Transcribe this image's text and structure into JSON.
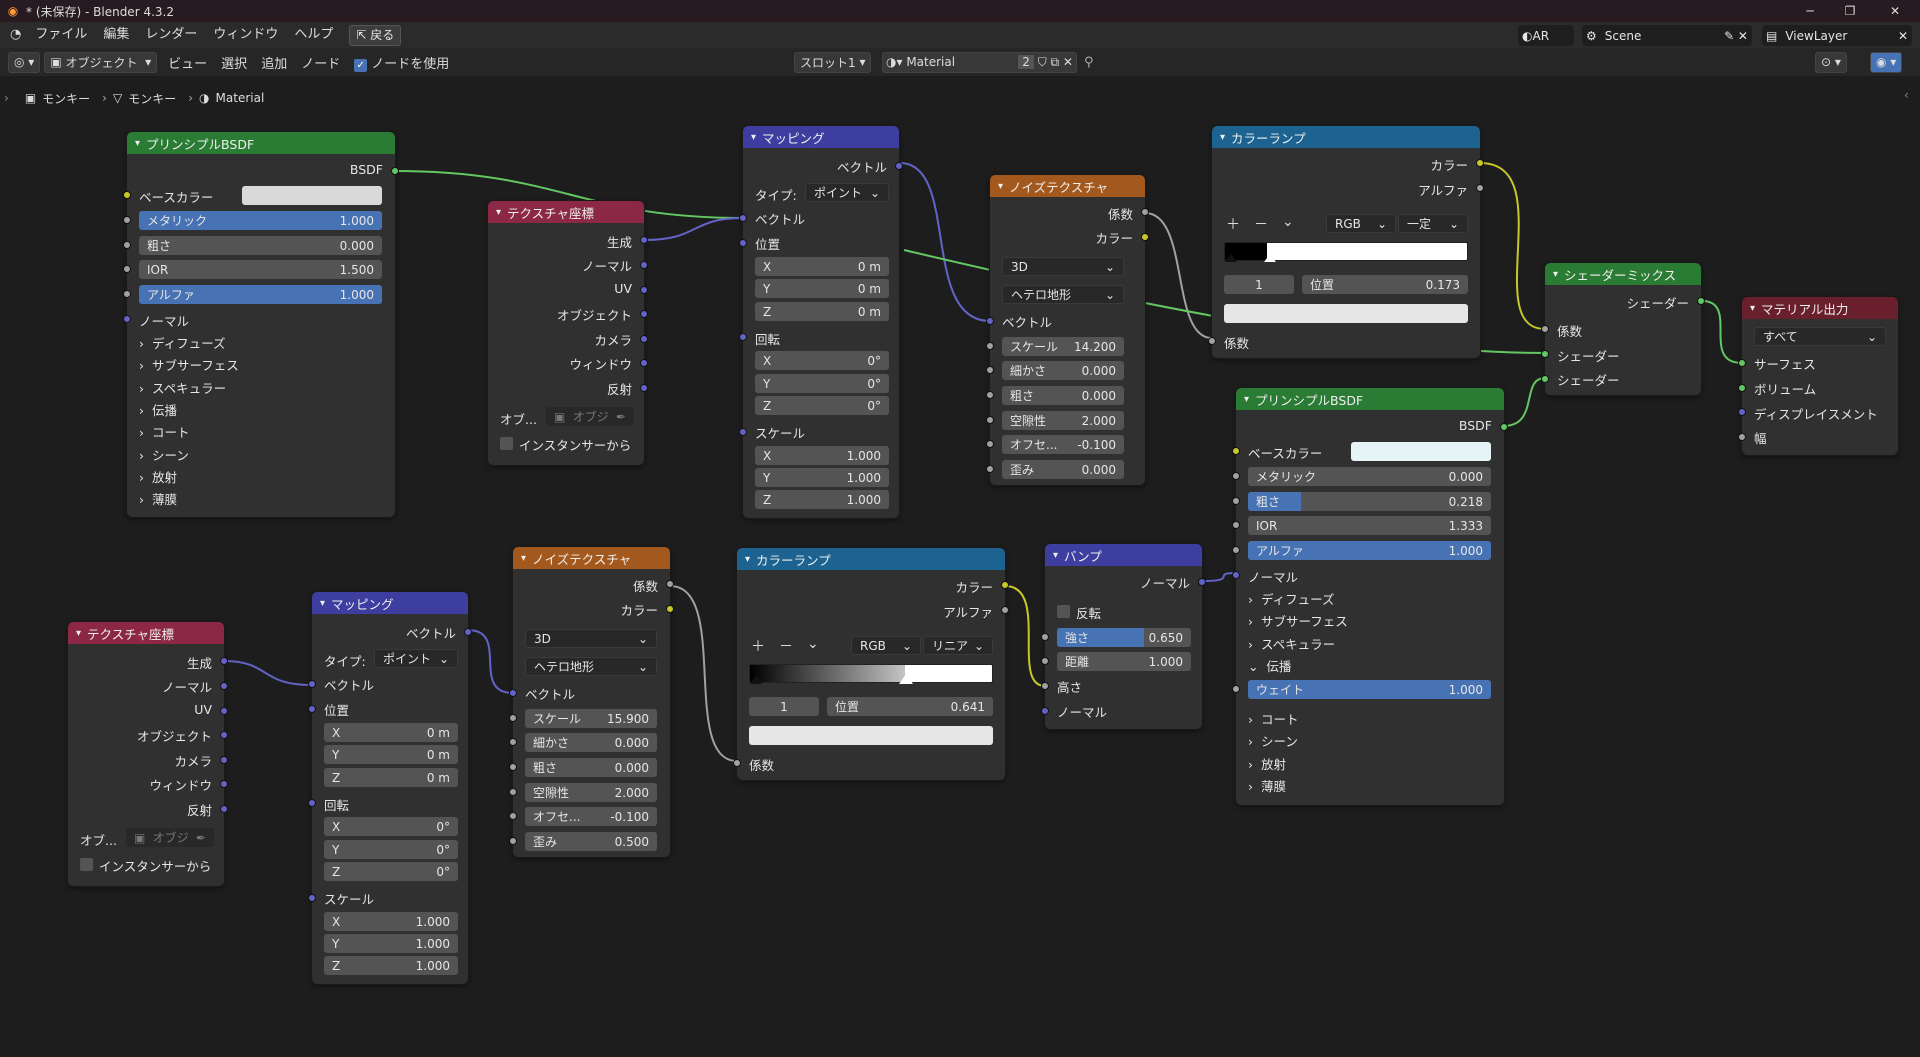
{
  "title": "* (未保存) - Blender 4.3.2",
  "menu": [
    "ファイル",
    "編集",
    "レンダー",
    "ウィンドウ",
    "ヘルプ"
  ],
  "back_label": "戻る",
  "scene": {
    "ar": "AR",
    "scene": "Scene",
    "view_layer": "ViewLayer"
  },
  "header": {
    "mode": "オブジェクト",
    "menus": [
      "ビュー",
      "選択",
      "追加",
      "ノード"
    ],
    "use_nodes": "ノードを使用",
    "slot": "スロット1",
    "material": "Material",
    "users": "2"
  },
  "breadcrumb": [
    "モンキー",
    "モンキー",
    "Material"
  ],
  "n1": {
    "title": "プリンシプルBSDF",
    "out": "BSDF",
    "base_color": "ベースカラー",
    "metallic": "メタリック",
    "metallic_v": "1.000",
    "rough": "粗さ",
    "rough_v": "0.000",
    "ior": "IOR",
    "ior_v": "1.500",
    "alpha": "アルファ",
    "alpha_v": "1.000",
    "normal": "ノーマル",
    "subs": [
      "ディフューズ",
      "サブサーフェス",
      "スペキュラー",
      "伝播",
      "コート",
      "シーン",
      "放射",
      "薄膜"
    ]
  },
  "tc1": {
    "title": "テクスチャ座標",
    "outs": [
      "生成",
      "ノーマル",
      "UV",
      "オブジェクト",
      "カメラ",
      "ウィンドウ",
      "反射"
    ],
    "obj": "オブ...",
    "obj_ph": "オブジ",
    "inst": "インスタンサーから"
  },
  "map1": {
    "title": "マッピング",
    "out": "ベクトル",
    "type_l": "タイプ:",
    "type_v": "ポイント",
    "vec": "ベクトル",
    "loc": "位置",
    "rot": "回転",
    "scale": "スケール",
    "lx": "0 m",
    "ly": "0 m",
    "lz": "0 m",
    "rx": "0°",
    "ry": "0°",
    "rz": "0°",
    "sx": "1.000",
    "sy": "1.000",
    "sz": "1.000",
    "X": "X",
    "Y": "Y",
    "Z": "Z"
  },
  "nt1": {
    "title": "ノイズテクスチャ",
    "fac": "係数",
    "col": "カラー",
    "dim": "3D",
    "type": "ヘテロ地形",
    "vec": "ベクトル",
    "scale": "スケール",
    "scale_v": "14.200",
    "detail": "細かさ",
    "detail_v": "0.000",
    "rough": "粗さ",
    "rough_v": "0.000",
    "lac": "空隙性",
    "lac_v": "2.000",
    "off": "オフセ...",
    "off_v": "-0.100",
    "dist": "歪み",
    "dist_v": "0.000"
  },
  "cr1": {
    "title": "カラーランプ",
    "col": "カラー",
    "alpha": "アルファ",
    "mode": "RGB",
    "interp": "一定",
    "idx": "1",
    "pos": "位置",
    "pos_v": "0.173",
    "fac": "係数"
  },
  "mix": {
    "title": "シェーダーミックス",
    "out": "シェーダー",
    "fac": "係数",
    "s1": "シェーダー",
    "s2": "シェーダー"
  },
  "mout": {
    "title": "マテリアル出力",
    "target": "すべて",
    "surface": "サーフェス",
    "volume": "ボリューム",
    "disp": "ディスプレイスメント",
    "thick": "幅"
  },
  "n2": {
    "title": "プリンシプルBSDF",
    "out": "BSDF",
    "base_color": "ベースカラー",
    "metallic": "メタリック",
    "metallic_v": "0.000",
    "rough": "粗さ",
    "rough_v": "0.218",
    "ior": "IOR",
    "ior_v": "1.333",
    "alpha": "アルファ",
    "alpha_v": "1.000",
    "normal": "ノーマル",
    "sub1": [
      "ディフューズ",
      "サブサーフェス",
      "スペキュラー"
    ],
    "trans": "伝播",
    "weight": "ウェイト",
    "weight_v": "1.000",
    "sub2": [
      "コート",
      "シーン",
      "放射",
      "薄膜"
    ]
  },
  "tc2": {
    "title": "テクスチャ座標",
    "outs": [
      "生成",
      "ノーマル",
      "UV",
      "オブジェクト",
      "カメラ",
      "ウィンドウ",
      "反射"
    ],
    "obj": "オブ...",
    "obj_ph": "オブジ",
    "inst": "インスタンサーから"
  },
  "map2": {
    "title": "マッピング",
    "out": "ベクトル",
    "type_l": "タイプ:",
    "type_v": "ポイント",
    "vec": "ベクトル",
    "loc": "位置",
    "rot": "回転",
    "scale": "スケール",
    "lx": "0 m",
    "ly": "0 m",
    "lz": "0 m",
    "rx": "0°",
    "ry": "0°",
    "rz": "0°",
    "sx": "1.000",
    "sy": "1.000",
    "sz": "1.000",
    "X": "X",
    "Y": "Y",
    "Z": "Z"
  },
  "nt2": {
    "title": "ノイズテクスチャ",
    "fac": "係数",
    "col": "カラー",
    "dim": "3D",
    "type": "ヘテロ地形",
    "vec": "ベクトル",
    "scale": "スケール",
    "scale_v": "15.900",
    "detail": "細かさ",
    "detail_v": "0.000",
    "rough": "粗さ",
    "rough_v": "0.000",
    "lac": "空隙性",
    "lac_v": "2.000",
    "off": "オフセ...",
    "off_v": "-0.100",
    "dist": "歪み",
    "dist_v": "0.500"
  },
  "cr2": {
    "title": "カラーランプ",
    "col": "カラー",
    "alpha": "アルファ",
    "mode": "RGB",
    "interp": "リニア",
    "idx": "1",
    "pos": "位置",
    "pos_v": "0.641",
    "fac": "係数"
  },
  "bump": {
    "title": "バンプ",
    "out": "ノーマル",
    "invert": "反転",
    "strength": "強さ",
    "strength_v": "0.650",
    "dist": "距離",
    "dist_v": "1.000",
    "height": "高さ",
    "normal": "ノーマル"
  },
  "colors": {
    "shader": "#2a7b33",
    "input": "#8c2846",
    "vector": "#3e3ea0",
    "texture": "#a3591e",
    "converter": "#1c6391",
    "output": "#6a1f2d",
    "accent": "#4772b3"
  }
}
